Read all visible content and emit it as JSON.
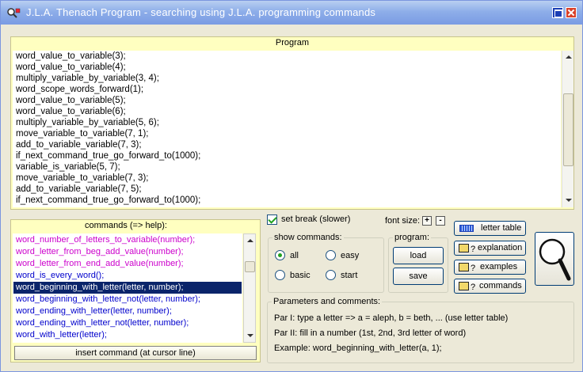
{
  "window": {
    "title": "J.L.A. Thenach Program - searching using J.L.A. programming commands",
    "title_color": "#ffffff"
  },
  "program": {
    "header": "Program",
    "lines": [
      "word_value_to_variable(3);",
      "word_value_to_variable(4);",
      "multiply_variable_by_variable(3, 4);",
      "word_scope_words_forward(1);",
      "word_value_to_variable(5);",
      "word_value_to_variable(6);",
      "multiply_variable_by_variable(5, 6);",
      "move_variable_to_variable(7, 1);",
      "add_to_variable_variable(7, 3);",
      "if_next_command_true_go_forward_to(1000);",
      "variable_is_variable(5, 7);",
      "move_variable_to_variable(7, 3);",
      "add_to_variable_variable(7, 5);",
      "if_next_command_true_go_forward_to(1000);"
    ]
  },
  "commands": {
    "header": "commands (=> help):",
    "items": [
      {
        "text": "word_number_of_letters_to_variable(number);",
        "color": "#cc00cc"
      },
      {
        "text": "word_letter_from_beg_add_value(number);",
        "color": "#cc00cc"
      },
      {
        "text": "word_letter_from_end_add_value(number);",
        "color": "#cc00cc"
      },
      {
        "text": "word_is_every_word();",
        "color": "#0000cc"
      },
      {
        "text": "word_beginning_with_letter(letter, number);",
        "color": "#ffffff"
      },
      {
        "text": "word_beginning_with_letter_not(letter, number);",
        "color": "#0000cc"
      },
      {
        "text": "word_ending_with_letter(letter, number);",
        "color": "#0000cc"
      },
      {
        "text": "word_ending_with_letter_not(letter, number);",
        "color": "#0000cc"
      },
      {
        "text": "word_with_letter(letter);",
        "color": "#0000cc"
      }
    ],
    "selected_index": 4,
    "insert_button": "insert command (at cursor line)"
  },
  "options": {
    "set_break_label": "set break (slower)",
    "set_break_checked": true,
    "font_size_label": "font size:",
    "font_plus": "+",
    "font_minus": "-"
  },
  "show_commands": {
    "legend": "show commands:",
    "options": [
      "all",
      "easy",
      "basic",
      "start"
    ],
    "selected": "all"
  },
  "program_group": {
    "legend": "program:",
    "load_label": "load",
    "save_label": "save"
  },
  "side_buttons": {
    "letter_table": "letter table",
    "explanation": "explanation",
    "examples": "examples",
    "commands": "commands",
    "icon_glyph": "?"
  },
  "parameters": {
    "legend": "Parameters and comments:",
    "lines": [
      "Par I: type a letter => a = aleph, b = beth, ... (use letter table)",
      "Par II: fill in a number (1st, 2nd, 3rd letter of word)",
      "Example: word_beginning_with_letter(a, 1);"
    ]
  }
}
